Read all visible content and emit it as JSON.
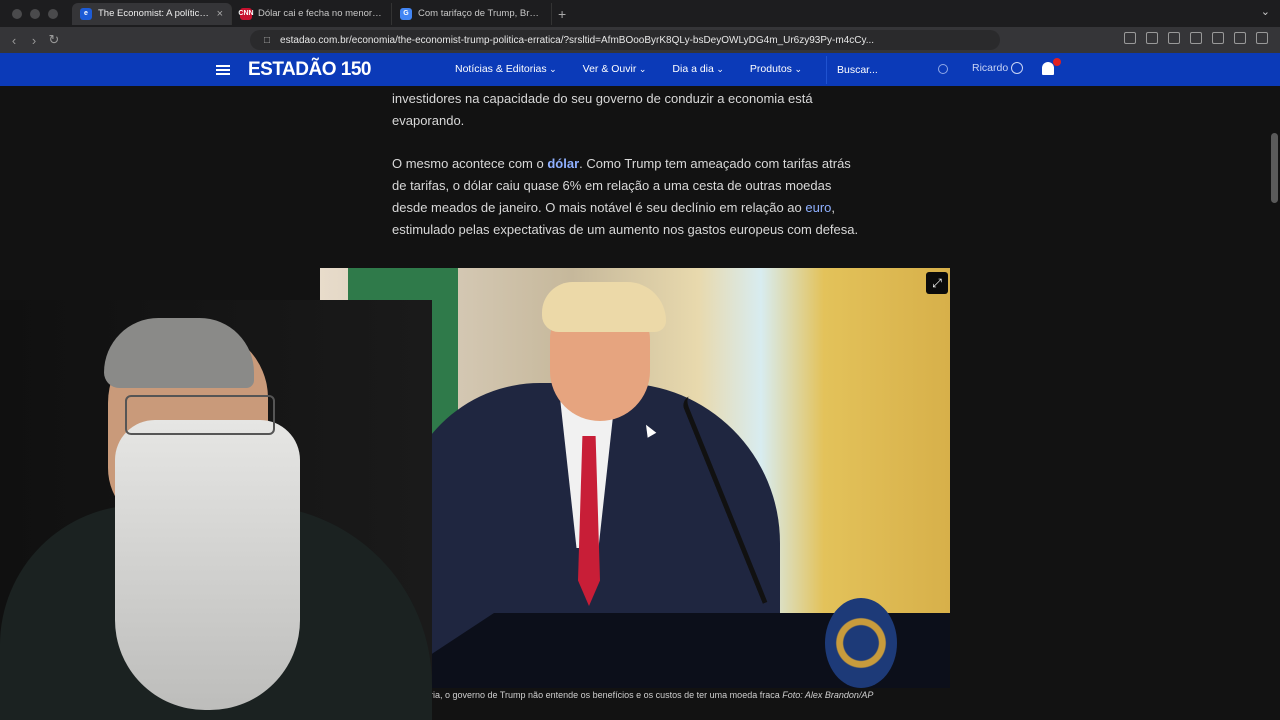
{
  "browser": {
    "tabs": [
      {
        "title": "The Economist: A política erratica",
        "fav_color": "#1d5bd6",
        "fav_text": "e",
        "active": true
      },
      {
        "title": "Dólar cai e fecha no menor valor desde",
        "fav_color": "#c8102e",
        "fav_text": "CNN",
        "active": false
      },
      {
        "title": "Com tarifaço de Trump, Brasil pode",
        "fav_color": "#4285f4",
        "fav_text": "G",
        "active": false
      }
    ],
    "new_tab": "+",
    "close": "×",
    "url": "estadao.com.br/economia/the-economist-trump-politica-erratica/?srsltid=AfmBOooByrK8QLy-bsDeyOWLyDG4m_Ur6zy93Py-m4cCy..."
  },
  "site": {
    "logo": "ESTADÃO 150",
    "nav": [
      "Notícias & Editorias",
      "Ver & Ouvir",
      "Dia a dia",
      "Produtos"
    ],
    "search_placeholder": "Buscar...",
    "user": "Ricardo"
  },
  "article": {
    "p1": "investidores na capacidade do seu governo de conduzir a economia está evaporando.",
    "p2_a": "O mesmo acontece com o ",
    "p2_link1": "dólar",
    "p2_b": ". Como Trump tem ameaçado com tarifas atrás de tarifas, o dólar caiu quase 6% em relação a uma cesta de outras moedas desde meados de janeiro. O mais notável é seu declínio em relação ao ",
    "p2_link2": "euro",
    "p2_c": ", estimulado pelas expectativas de um aumento nos gastos europeus com defesa.",
    "caption": "ária, o governo de Trump não entende os benefícios e os custos de ter uma moeda fraca ",
    "caption_credit": "Foto: Alex Brandon/AP"
  },
  "colors": {
    "header": "#0b3ab8",
    "link": "#8fb0ff",
    "notif": "#e02020"
  }
}
